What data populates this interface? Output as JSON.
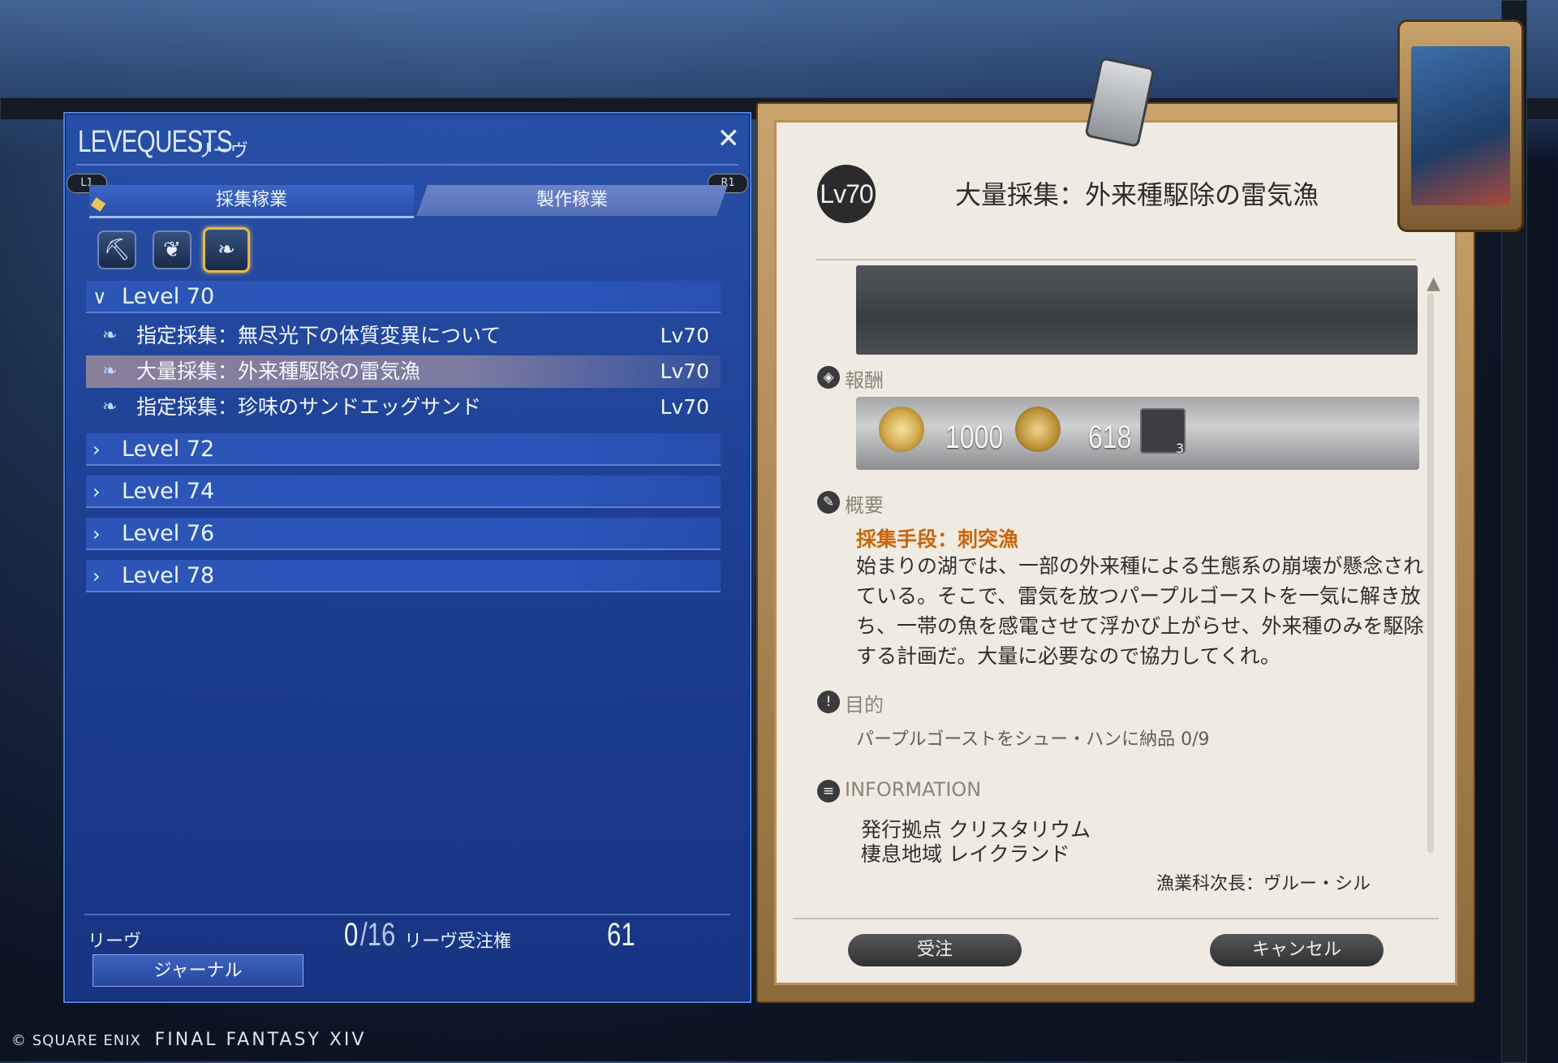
{
  "levequests": {
    "title": "LEVEQUESTS",
    "subtitle": "リーヴ",
    "close_glyph": "✕",
    "tabs": {
      "left_badge": "L1",
      "right_badge": "R1",
      "gathering": "採集稼業",
      "crafting": "製作稼業"
    },
    "class_icons": [
      "miner-icon",
      "botanist-icon",
      "fisher-icon"
    ],
    "selected_class": "fisher-icon",
    "level_groups": [
      {
        "label": "Level 70",
        "expanded": true,
        "quests": [
          {
            "name": "指定採集：無尽光下の体質変異について",
            "level": "Lv70",
            "selected": false
          },
          {
            "name": "大量採集：外来種駆除の雷気漁",
            "level": "Lv70",
            "selected": true
          },
          {
            "name": "指定採集：珍味のサンドエッグサンド",
            "level": "Lv70",
            "selected": false
          }
        ]
      },
      {
        "label": "Level 72",
        "expanded": false
      },
      {
        "label": "Level 74",
        "expanded": false
      },
      {
        "label": "Level 76",
        "expanded": false
      },
      {
        "label": "Level 78",
        "expanded": false
      }
    ],
    "footer": {
      "leve_label": "リーヴ",
      "leve_count": "0",
      "leve_max": "/16",
      "allowance_label": "リーヴ受注権",
      "allowance_value": "61",
      "journal_button": "ジャーナル"
    }
  },
  "detail": {
    "level_badge": "Lv70",
    "title": "大量採集：外来種駆除の雷気漁",
    "rewards_label": "報酬",
    "rewards": {
      "exp": "1000",
      "gil": "618",
      "item_count": "3"
    },
    "summary_label": "概要",
    "method": "採集手段：刺突漁",
    "description": "始まりの湖では、一部の外来種による生態系の崩壊が懸念されている。そこで、雷気を放つパープルゴーストを一気に解き放ち、一帯の魚を感電させて浮かび上がらせ、外来種のみを駆除する計画だ。大量に必要なので協力してくれ。",
    "objective_label": "目的",
    "objective": "パープルゴーストをシュー・ハンに納品 0/9",
    "info_label": "INFORMATION",
    "info_lines": [
      "発行拠点 クリスタリウム",
      "棲息地域 レイクランド"
    ],
    "issuer": "漁業科次長：ヴルー・シル",
    "accept_button": "受注",
    "cancel_button": "キャンセル"
  },
  "copyright": {
    "company": "© SQUARE ENIX",
    "game": "FINAL FANTASY XIV"
  },
  "colors": {
    "panel_blue": "#2a56bb",
    "accent_gold": "#e8b84e",
    "method_orange": "#c8650c",
    "parchment": "#efebe2"
  }
}
